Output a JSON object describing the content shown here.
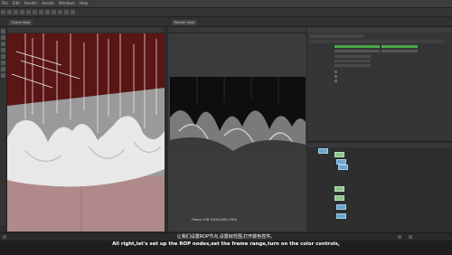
{
  "menubar": {
    "items": [
      "File",
      "Edit",
      "Render",
      "Assets",
      "Windows",
      "Help"
    ]
  },
  "viewer_panel": {
    "tabs": [
      "Scene View",
      "Render View"
    ]
  },
  "render_view": {
    "frame_label": "Frame: 128 1920x1080 100%"
  },
  "subtitles": {
    "chinese": "让我们设置ROP节点,设置帧范围,打开颜色控件。",
    "english": "All right,let's set up the ROP nodes,set the frame range,turn on the color controls,"
  },
  "colors": {
    "background": "#2b2b2b",
    "viewport_red": "#5a1515",
    "node_blue": "#6ca5c9",
    "node_green": "#8fc48f",
    "param_green": "#4aa84a"
  }
}
